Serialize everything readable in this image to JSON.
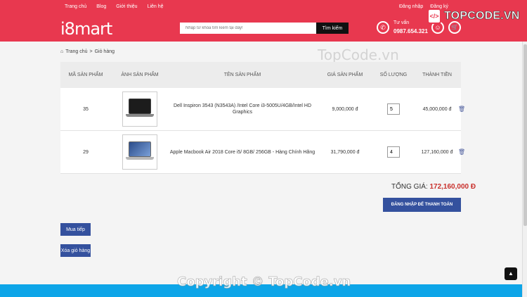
{
  "topnav": {
    "items": [
      "Trang chủ",
      "Blog",
      "Giới thiệu",
      "Liên hệ"
    ],
    "login": "Đăng nhập",
    "register": "Đăng ký"
  },
  "header": {
    "logo": "i8mart",
    "search_placeholder": "Nhập từ khóa tìm kiếm tại đây!",
    "search_button": "Tìm kiếm",
    "consult_label": "Tư vấn",
    "phone": "0987.654.321"
  },
  "watermark": {
    "brand": "TOPCODE.VN",
    "middle": "TopCode.vn",
    "copyright": "Copyright © TopCode.vn"
  },
  "breadcrumb": {
    "home": "Trang chủ",
    "separator": ">",
    "current": "Giỏ hàng"
  },
  "cart": {
    "headers": {
      "id": "MÃ SẢN PHẨM",
      "image": "ẢNH SẢN PHẨM",
      "name": "TÊN SẢN PHẨM",
      "price": "GIÁ SẢN PHẨM",
      "qty": "SỐ LƯỢNG",
      "total": "THÀNH TIỀN"
    },
    "rows": [
      {
        "id": "35",
        "name": "Dell Inspiron 3543 (N3543A) /Intel Core i3-5005U/4GB/Intel HD Graphics",
        "price": "9,000,000 đ",
        "qty": "5",
        "total": "45,000,000 đ",
        "image_icon": "laptop-dell-image"
      },
      {
        "id": "29",
        "name": "Apple Macbook Air 2018 Core i5/ 8GB/ 256GB - Hàng Chính Hãng",
        "price": "31,790,000 đ",
        "qty": "4",
        "total": "127,160,000 đ",
        "image_icon": "laptop-macbook-image"
      }
    ],
    "total_label": "TỔNG GIÁ:",
    "total_amount": "172,160,000 Đ",
    "checkout_button": "ĐĂNG NHẬP ĐỂ THANH TOÁN",
    "continue_button": "Mua tiếp",
    "clear_button": "Xóa giỏ hàng"
  },
  "colors": {
    "brand_red": "#e8384f",
    "button_blue": "#34519e",
    "footer_blue": "#0da5e8",
    "price_red": "#c9302c"
  }
}
